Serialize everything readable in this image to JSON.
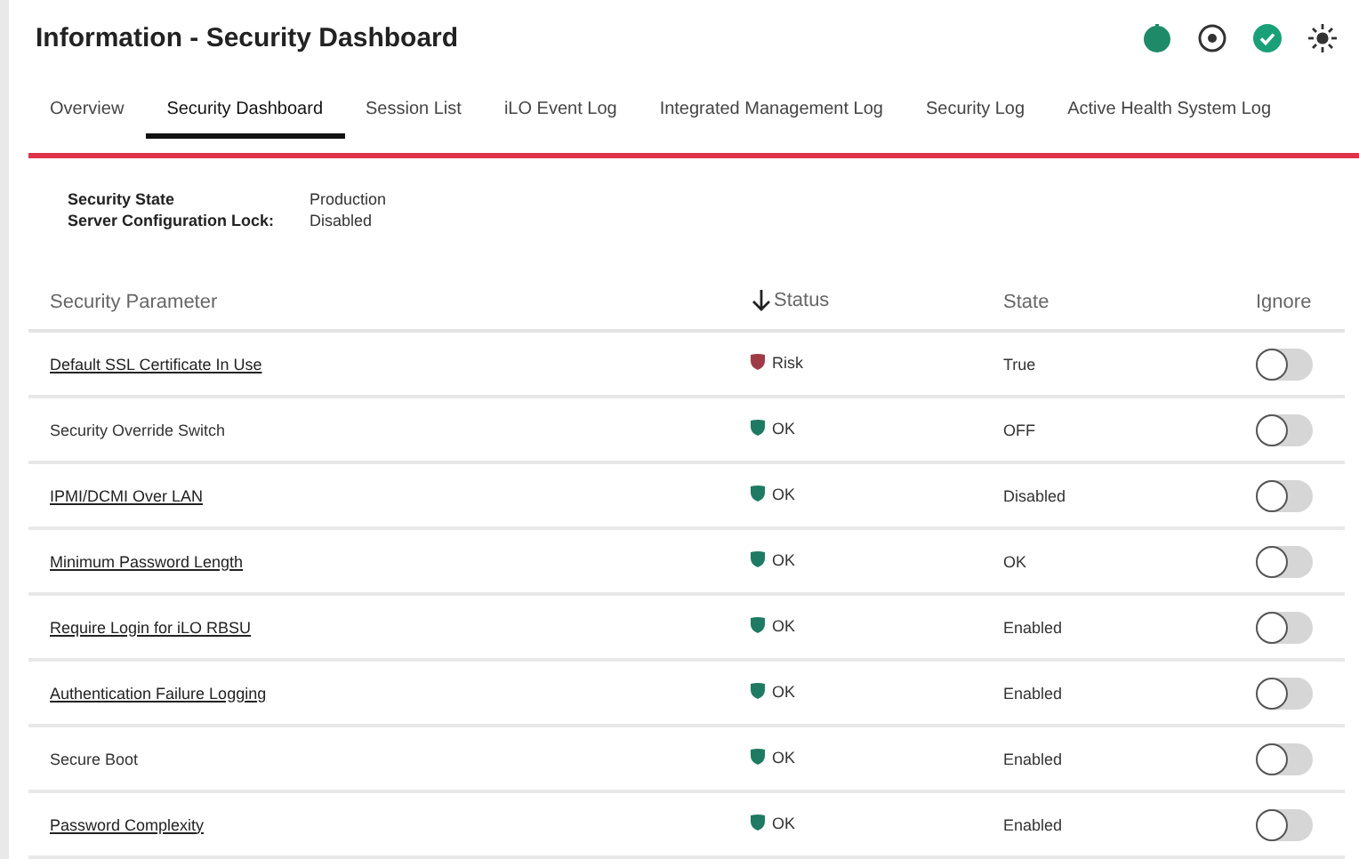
{
  "window": {
    "title": "Information - Security Dashboard"
  },
  "tabs": [
    {
      "label": "Overview",
      "selected": false
    },
    {
      "label": "Security Dashboard",
      "selected": true
    },
    {
      "label": "Session List",
      "selected": false
    },
    {
      "label": "iLO Event Log",
      "selected": false
    },
    {
      "label": "Integrated Management Log",
      "selected": false
    },
    {
      "label": "Security Log",
      "selected": false
    },
    {
      "label": "Active Health System Log",
      "selected": false
    }
  ],
  "summary": [
    {
      "label": "Security State",
      "value": "Production"
    },
    {
      "label": "Server Configuration Lock:",
      "value": "Disabled"
    }
  ],
  "table": {
    "columns": [
      "Security Parameter",
      "Status",
      "State",
      "Ignore"
    ],
    "rows": [
      {
        "parameter": "Default SSL Certificate In Use",
        "link": true,
        "status": "Risk",
        "kind": "risk",
        "state": "True",
        "ignore": false
      },
      {
        "parameter": "Security Override Switch",
        "link": false,
        "status": "OK",
        "kind": "ok",
        "state": "OFF",
        "ignore": false
      },
      {
        "parameter": "IPMI/DCMI Over LAN",
        "link": true,
        "status": "OK",
        "kind": "ok",
        "state": "Disabled",
        "ignore": false
      },
      {
        "parameter": "Minimum Password Length",
        "link": true,
        "status": "OK",
        "kind": "ok",
        "state": "OK",
        "ignore": false
      },
      {
        "parameter": "Require Login for iLO RBSU",
        "link": true,
        "status": "OK",
        "kind": "ok",
        "state": "Enabled",
        "ignore": false
      },
      {
        "parameter": "Authentication Failure Logging",
        "link": true,
        "status": "OK",
        "kind": "ok",
        "state": "Enabled",
        "ignore": false
      },
      {
        "parameter": "Secure Boot",
        "link": false,
        "status": "OK",
        "kind": "ok",
        "state": "Enabled",
        "ignore": false
      },
      {
        "parameter": "Password Complexity",
        "link": true,
        "status": "OK",
        "kind": "ok",
        "state": "Enabled",
        "ignore": false
      }
    ]
  }
}
